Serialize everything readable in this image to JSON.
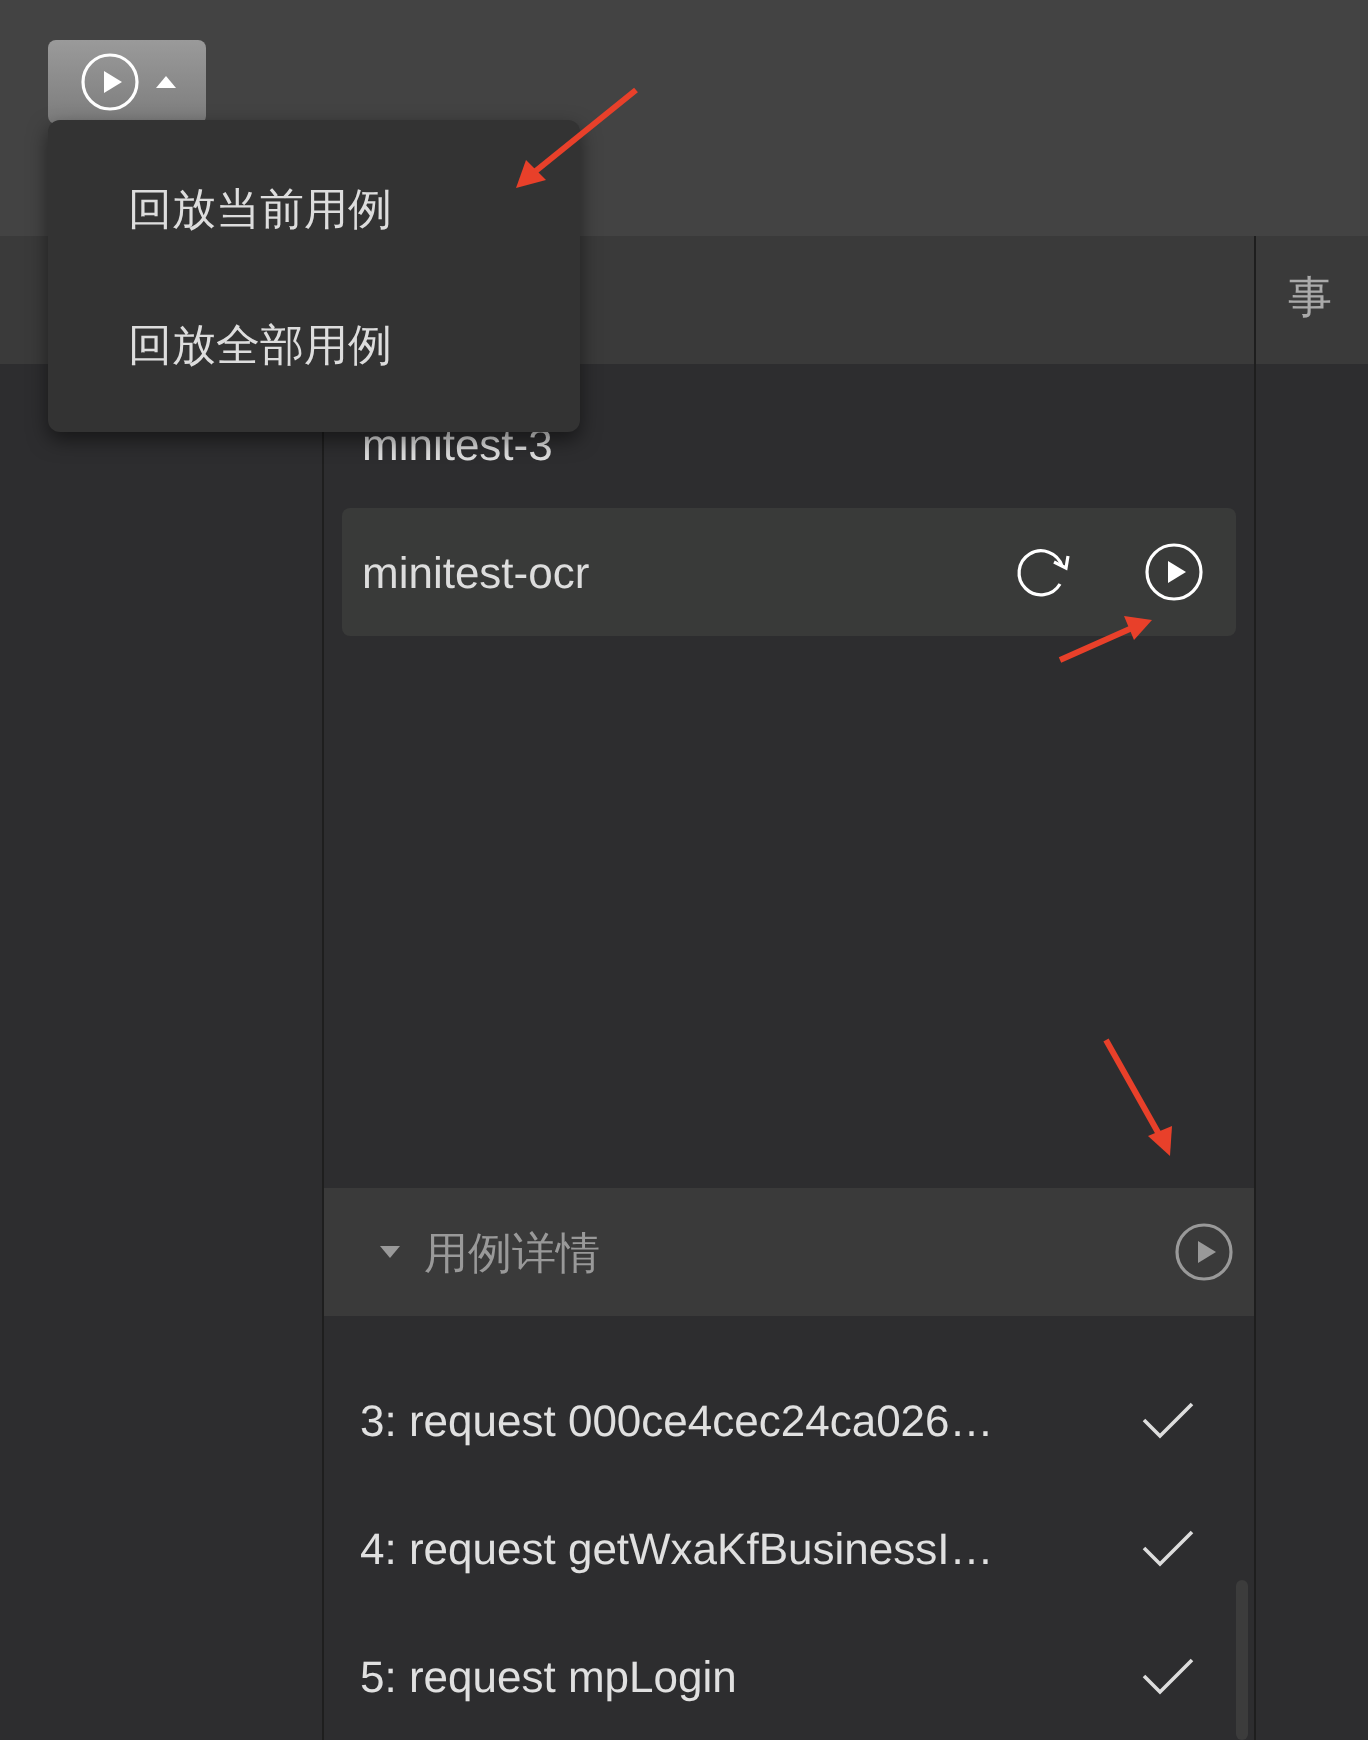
{
  "toolbar": {
    "play_menu_button": {
      "expanded": true
    }
  },
  "menu": {
    "items": [
      {
        "label": "回放当前用例"
      },
      {
        "label": "回放全部用例"
      }
    ]
  },
  "header": {
    "column_3": "事"
  },
  "cases": [
    {
      "name": "minitest-3",
      "selected": false
    },
    {
      "name": "minitest-ocr",
      "selected": true
    }
  ],
  "details": {
    "title": "用例详情",
    "expanded": true,
    "steps": [
      {
        "label": "3: request 000ce4cec24ca026…",
        "done": true
      },
      {
        "label": "4: request getWxaKfBusinessI…",
        "done": true
      },
      {
        "label": "5: request mpLogin",
        "done": true
      }
    ]
  }
}
